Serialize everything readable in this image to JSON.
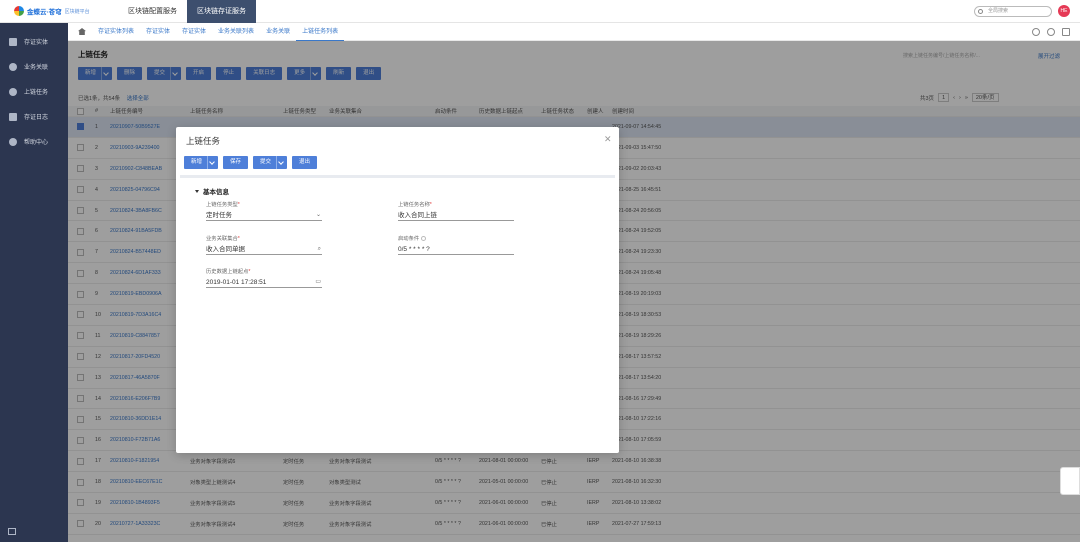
{
  "topbar": {
    "logo_text": "金蝶云·苍穹",
    "logo_sub": "区块链平台",
    "tabs": [
      "区块链配置服务",
      "区块链存证服务"
    ],
    "active_tab": 1,
    "search_placeholder": "全局搜索",
    "avatar_text": "HE"
  },
  "sidebar": {
    "items": [
      {
        "label": "存证实体",
        "icon": "entity-icon"
      },
      {
        "label": "业务关联",
        "icon": "link-icon"
      },
      {
        "label": "上链任务",
        "icon": "task-icon"
      },
      {
        "label": "存证日志",
        "icon": "log-icon"
      },
      {
        "label": "帮助中心",
        "icon": "help-icon"
      }
    ]
  },
  "subnav": {
    "items": [
      "存证实体列表",
      "存证实体",
      "存证实体",
      "业务关联列表",
      "业务关联",
      "上链任务列表"
    ],
    "active_index": 5
  },
  "page": {
    "title": "上链任务",
    "toolbar": [
      "新增",
      "删除",
      "提交",
      "开启",
      "停止",
      "关联日志",
      "更多",
      "刷新",
      "退出"
    ],
    "search_placeholder": "搜索上链任务编号/上链任务名称/...",
    "expand_filter": "展开过滤",
    "selection_info": "已选1条，共54条",
    "select_all": "选择全部",
    "pager": {
      "total_pages": "共3页",
      "current": "1",
      "page_size": "20条/页"
    }
  },
  "table": {
    "headers": [
      "#",
      "上链任务编号",
      "上链任务名称",
      "上链任务类型",
      "业务关联集合",
      "启动条件",
      "历史数据上链起点",
      "上链任务状态",
      "创建人",
      "创建时间"
    ],
    "rows": [
      {
        "no": "1",
        "id": "20210907-50B9527E",
        "name": "",
        "type": "",
        "biz": "",
        "cond": "",
        "hist": "",
        "status": "",
        "creator": "",
        "time": "2021-09-07 14:54:45",
        "selected": true
      },
      {
        "no": "2",
        "id": "20210903-9A239400",
        "name": "",
        "type": "",
        "biz": "",
        "cond": "",
        "hist": "",
        "status": "",
        "creator": "",
        "time": "2021-09-03 15:47:50"
      },
      {
        "no": "3",
        "id": "20210902-C848BEAB",
        "name": "",
        "type": "",
        "biz": "",
        "cond": "",
        "hist": "",
        "status": "",
        "creator": "",
        "time": "2021-09-02 20:03:43"
      },
      {
        "no": "4",
        "id": "20210825-04796C94",
        "name": "",
        "type": "",
        "biz": "",
        "cond": "",
        "hist": "",
        "status": "",
        "creator": "",
        "time": "2021-08-25 16:45:51"
      },
      {
        "no": "5",
        "id": "20210824-3BA8FB6C",
        "name": "",
        "type": "",
        "biz": "",
        "cond": "",
        "hist": "",
        "status": "",
        "creator": "",
        "time": "2021-08-24 20:56:05"
      },
      {
        "no": "6",
        "id": "20210824-91BA5FDB",
        "name": "",
        "type": "",
        "biz": "",
        "cond": "",
        "hist": "",
        "status": "",
        "creator": "",
        "time": "2021-08-24 19:52:05"
      },
      {
        "no": "7",
        "id": "20210824-B57448ED",
        "name": "",
        "type": "",
        "biz": "",
        "cond": "",
        "hist": "",
        "status": "",
        "creator": "",
        "time": "2021-08-24 19:23:30"
      },
      {
        "no": "8",
        "id": "20210824-6D1AF333",
        "name": "",
        "type": "",
        "biz": "",
        "cond": "",
        "hist": "",
        "status": "",
        "creator": "",
        "time": "2021-08-24 19:05:48"
      },
      {
        "no": "9",
        "id": "20210819-EBD0906A",
        "name": "",
        "type": "",
        "biz": "",
        "cond": "",
        "hist": "",
        "status": "",
        "creator": "",
        "time": "2021-08-19 20:19:03"
      },
      {
        "no": "10",
        "id": "20210819-7D3A16C4",
        "name": "",
        "type": "",
        "biz": "",
        "cond": "",
        "hist": "",
        "status": "",
        "creator": "",
        "time": "2021-08-19 18:30:53"
      },
      {
        "no": "11",
        "id": "20210819-C8847857",
        "name": "",
        "type": "",
        "biz": "",
        "cond": "",
        "hist": "",
        "status": "",
        "creator": "",
        "time": "2021-08-19 18:29:26"
      },
      {
        "no": "12",
        "id": "20210817-20FD4520",
        "name": "",
        "type": "",
        "biz": "",
        "cond": "",
        "hist": "",
        "status": "",
        "creator": "",
        "time": "2021-08-17 13:57:52"
      },
      {
        "no": "13",
        "id": "20210817-46A5870F",
        "name": "",
        "type": "",
        "biz": "",
        "cond": "",
        "hist": "",
        "status": "",
        "creator": "",
        "time": "2021-08-17 13:54:20"
      },
      {
        "no": "14",
        "id": "20210816-E206F7B9",
        "name": "",
        "type": "",
        "biz": "",
        "cond": "",
        "hist": "",
        "status": "",
        "creator": "",
        "time": "2021-08-16 17:29:49"
      },
      {
        "no": "15",
        "id": "20210810-36DD1E14",
        "name": "",
        "type": "",
        "biz": "",
        "cond": "",
        "hist": "",
        "status": "",
        "creator": "",
        "time": "2021-08-10 17:22:16"
      },
      {
        "no": "16",
        "id": "20210810-F72B71A6",
        "name": "",
        "type": "",
        "biz": "",
        "cond": "",
        "hist": "",
        "status": "",
        "creator": "",
        "time": "2021-08-10 17:05:59"
      },
      {
        "no": "17",
        "id": "20210810-F1821954",
        "name": "业务对象字段测试6",
        "type": "定时任务",
        "biz": "业务对象字段测试",
        "cond": "0/5 * * * * ?",
        "hist": "2021-08-01 00:00:00",
        "status": "已停止",
        "creator": "IERP",
        "time": "2021-08-10 16:38:38"
      },
      {
        "no": "18",
        "id": "20210810-EEC67E1C",
        "name": "对象类型上链测试4",
        "type": "定时任务",
        "biz": "对象类型测试",
        "cond": "0/5 * * * * ?",
        "hist": "2021-05-01 00:00:00",
        "status": "已停止",
        "creator": "IERP",
        "time": "2021-08-10 16:32:30"
      },
      {
        "no": "19",
        "id": "20210810-1B4893F5",
        "name": "业务对象字段测试5",
        "type": "定时任务",
        "biz": "业务对象字段测试",
        "cond": "0/5 * * * * ?",
        "hist": "2021-06-01 00:00:00",
        "status": "已停止",
        "creator": "IERP",
        "time": "2021-08-10 13:38:02"
      },
      {
        "no": "20",
        "id": "20210727-1A33323C",
        "name": "业务对象字段测试4",
        "type": "定时任务",
        "biz": "业务对象字段测试",
        "cond": "0/5 * * * * ?",
        "hist": "2021-06-01 00:00:00",
        "status": "已停止",
        "creator": "IERP",
        "time": "2021-07-27 17:59:13"
      }
    ]
  },
  "modal": {
    "title": "上链任务",
    "toolbar": [
      "新增",
      "保存",
      "提交",
      "退出"
    ],
    "section": "基本信息",
    "fields": {
      "task_type": {
        "label": "上链任务类型",
        "value": "定时任务"
      },
      "task_name": {
        "label": "上链任务名称",
        "value": "收入合同上链"
      },
      "biz_set": {
        "label": "业务关联集合",
        "value": "收入合同单据"
      },
      "start_cond": {
        "label": "启动条件",
        "value": "0/5 * * * * ?"
      },
      "hist_start": {
        "label": "历史数据上链起点",
        "value": "2019-01-01 17:28:51"
      }
    }
  },
  "colors": {
    "primary": "#4e7fd9",
    "sidebar": "#2c3650",
    "active_tab": "#3d4f6e",
    "link": "#3a78c9"
  }
}
